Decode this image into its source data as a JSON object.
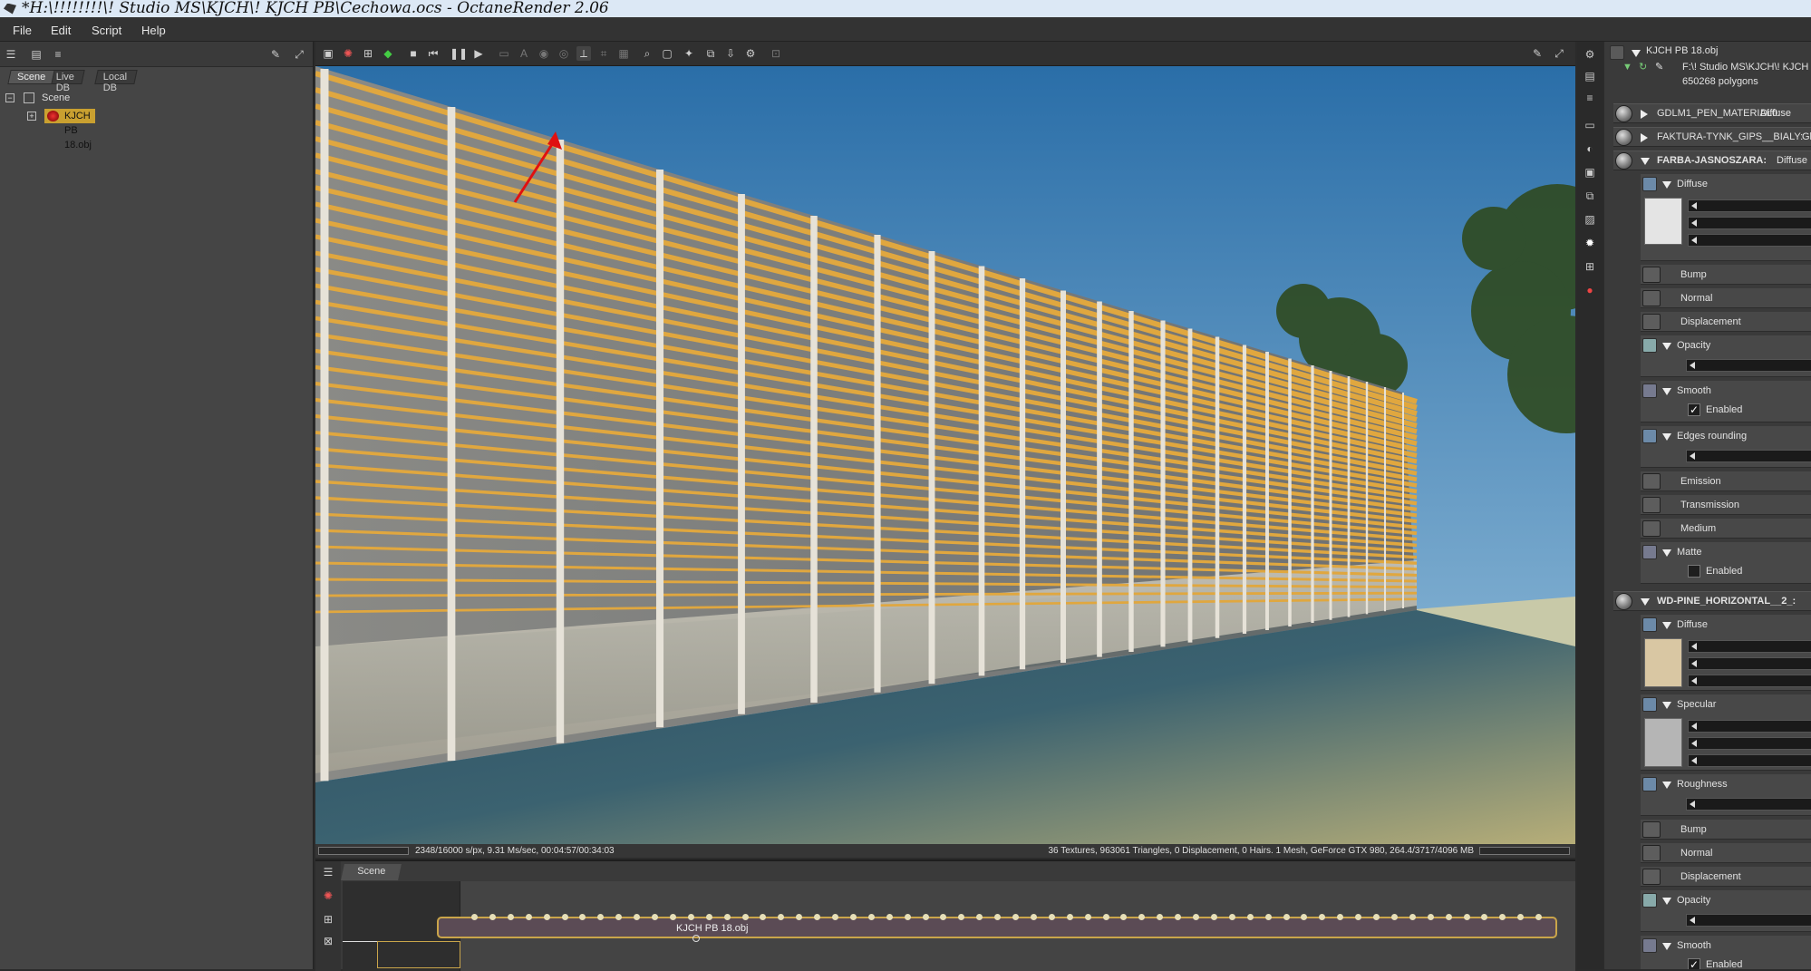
{
  "window": {
    "title": "*H:\\!!!!!!!!\\! Studio MS\\KJCH\\! KJCH PB\\Cechowa.ocs - OctaneRender 2.06"
  },
  "menu": {
    "items": [
      "File",
      "Edit",
      "Script",
      "Help"
    ]
  },
  "scene_panel": {
    "tabs": [
      "Scene",
      "Live DB",
      "Local DB"
    ],
    "tree": {
      "root": "Scene",
      "child": "KJCH PB 18.obj"
    }
  },
  "viewport": {
    "status_left": "2348/16000 s/px, 9.31 Ms/sec, 00:04:57/00:34:03",
    "status_right": "36 Textures, 963061 Triangles, 0 Displacement, 0 Hairs. 1 Mesh, GeForce GTX 980, 264.4/3717/4096 MB"
  },
  "graph_editor": {
    "tab": "Scene",
    "node_label": "KJCH PB 18.obj"
  },
  "inspector": {
    "header": {
      "title": "KJCH PB 18.obj",
      "path": "F:\\! Studio MS\\KJCH\\! KJCH P",
      "polygons": "650268 polygons"
    },
    "materials": [
      {
        "name": "GDLM1_PEN_MATERIAL0:",
        "type": "Diffuse"
      },
      {
        "name": "FAKTURA-TYNK_GIPS__BIALY:",
        "type": "Glo"
      },
      {
        "name": "FARBA-JASNOSZARA:",
        "type": "Diffuse M"
      }
    ],
    "farba_pins": {
      "diffuse": "Diffuse",
      "bump": "Bump",
      "normal": "Normal",
      "displacement": "Displacement",
      "opacity": "Opacity",
      "smooth": "Smooth",
      "smooth_enabled": "Enabled",
      "edges": "Edges rounding",
      "emission": "Emission",
      "transmission": "Transmission",
      "medium": "Medium",
      "matte": "Matte",
      "matte_enabled": "Enabled"
    },
    "wd_material": {
      "name": "WD-PINE_HORIZONTAL__2_:"
    },
    "wd_pins": {
      "diffuse": "Diffuse",
      "specular": "Specular",
      "roughness": "Roughness",
      "bump": "Bump",
      "normal": "Normal",
      "displacement": "Displacement",
      "opacity": "Opacity",
      "smooth": "Smooth",
      "smooth_enabled": "Enabled"
    },
    "colors": {
      "farba_diffuse": "#e4e4e4",
      "wd_diffuse": "#d9c7a3",
      "wd_specular": "#b5b5b5"
    }
  }
}
